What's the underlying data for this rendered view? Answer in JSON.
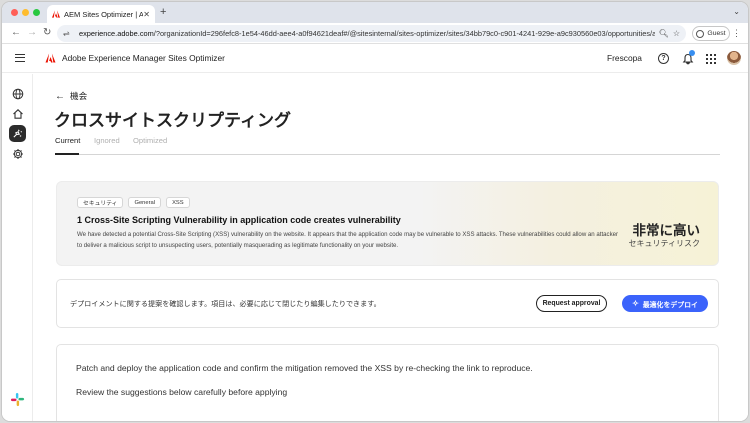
{
  "browser": {
    "tab_title": "AEM Sites Optimizer | Adobe",
    "url_host": "experience.adobe.com",
    "url_path": "/?organizationId=296fefc8-1e54-46dd-aee4-a0f94621deaf#/@sitesinternal/sites-optimizer/sites/34bb79c0-c901-4241-929e-a9c930560e03/opportunities/a0739bd...",
    "guest_label": "Guest"
  },
  "header": {
    "app_title": "Adobe Experience Manager Sites Optimizer",
    "org_name": "Frescopa"
  },
  "page": {
    "back_label": "機会",
    "title": "クロスサイトスクリプティング",
    "tabs": [
      "Current",
      "Ignored",
      "Optimized"
    ]
  },
  "hero": {
    "chips": [
      "セキュリティ",
      "General",
      "XSS"
    ],
    "title": "1 Cross-Site Scripting Vulnerability in application code creates vulnerability",
    "description": "We have detected a potential Cross-Site Scripting (XSS) vulnerability on the website. It appears that the application code may be vulnerable to XSS attacks. These vulnerabilities could allow an attacker to deliver a malicious script to unsuspecting users, potentially masquerading as legitimate functionality on your website.",
    "risk_level": "非常に高い",
    "risk_label": "セキュリティリスク"
  },
  "approval": {
    "text": "デプロイメントに関する提案を確認します。項目は、必要に応じて閉じたり編集したりできます。",
    "request_label": "Request approval",
    "deploy_label": "最適化をデプロイ"
  },
  "patch": {
    "line1": "Patch and deploy the application code and confirm the mitigation removed the XSS by re-checking the link to reproduce.",
    "line2": "Review the suggestions below carefully before applying"
  },
  "colors": {
    "accent": "#3b63fb",
    "rail_active": "#2c2c2c"
  }
}
